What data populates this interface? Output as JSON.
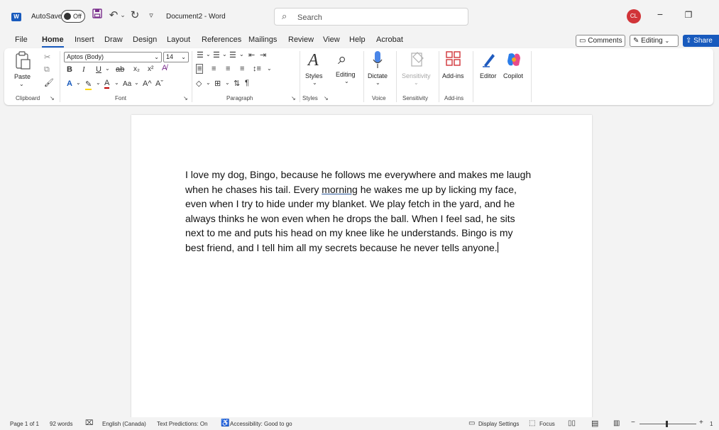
{
  "titlebar": {
    "app_icon": "W",
    "autosave_label": "AutoSave",
    "autosave_state": "Off",
    "save_icon": "floppy-disk-icon",
    "undo_icon": "undo-icon",
    "redo_icon": "redo-icon",
    "customize_icon": "customize-toolbar-icon",
    "document_title": "Document2 - Word",
    "search_placeholder": "Search",
    "avatar_initials": "CL"
  },
  "menu": {
    "tabs": [
      "File",
      "Home",
      "Insert",
      "Draw",
      "Design",
      "Layout",
      "References",
      "Mailings",
      "Review",
      "View",
      "Help",
      "Acrobat"
    ],
    "active_tab": "Home",
    "comments_label": "Comments",
    "editing_label": "Editing",
    "share_label": "Share"
  },
  "ribbon": {
    "paste_label": "Paste",
    "font_name": "Aptos (Body)",
    "font_size": "14",
    "styles_label": "Styles",
    "editing_label": "Editing",
    "dictate_label": "Dictate",
    "sensitivity_label": "Sensitivity",
    "addins_label": "Add-ins",
    "editor_label": "Editor",
    "copilot_label": "Copilot",
    "groups": {
      "clipboard": "Clipboard",
      "font": "Font",
      "paragraph": "Paragraph",
      "styles": "Styles",
      "voice": "Voice",
      "sensitivity": "Sensitivity",
      "addins": "Add-ins"
    },
    "font_buttons": {
      "bold": "B",
      "italic": "I",
      "underline": "U",
      "strike": "ab",
      "subscript": "x₂",
      "superscript": "x²",
      "change_case": "Aa",
      "grow": "A^",
      "shrink": "Aˇ"
    }
  },
  "document": {
    "lines": [
      "I love my dog, Bingo, because he follows me everywhere and makes me laugh",
      "when he chases his tail. Every ",
      "morning",
      " he wakes me up by licking my face,",
      "even when I try to hide under my blanket. We play fetch in the yard, and he",
      "always thinks he won even when he drops the ball. When I feel sad, he sits",
      "next to me and puts his head on my knee like he understands. Bingo is my",
      "best friend, and I tell him all my secrets because he never tells anyone."
    ]
  },
  "status": {
    "page": "Page 1 of 1",
    "words": "92 words",
    "language": "English (Canada)",
    "text_predictions": "Text Predictions: On",
    "accessibility": "Accessibility: Good to go",
    "display_settings": "Display Settings",
    "focus": "Focus",
    "zoom_minus": "−",
    "zoom_plus": "+",
    "zoom_value": "1"
  },
  "colors": {
    "accent": "#185abd",
    "avatar": "#d13438"
  }
}
